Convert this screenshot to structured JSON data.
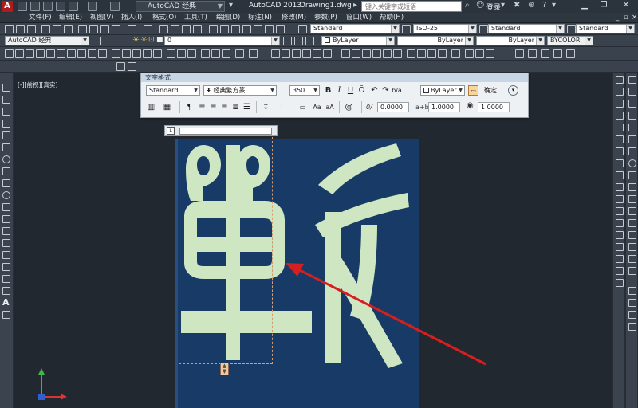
{
  "titlebar": {
    "logo": "A",
    "workspace": "AutoCAD 经典",
    "app_name": "AutoCAD 2013",
    "document": "Drawing1.dwg",
    "search_placeholder": "键入关键字或短语",
    "login": "登录"
  },
  "menu": [
    "文件(F)",
    "编辑(E)",
    "视图(V)",
    "插入(I)",
    "格式(O)",
    "工具(T)",
    "绘图(D)",
    "标注(N)",
    "修改(M)",
    "参数(P)",
    "窗口(W)",
    "帮助(H)"
  ],
  "toolbars": {
    "text_style": "Standard",
    "dim_style": "ISO-25",
    "table_style": "Standard",
    "multileader_style": "Standard",
    "workspace": "AutoCAD 经典",
    "layer": "0",
    "color": "ByLayer",
    "linetype": "ByLayer",
    "lineweight": "ByLayer",
    "plotstyle": "BYCOLOR"
  },
  "viewport": {
    "label": "[-][前视][真实]"
  },
  "text_format": {
    "title": "文字格式",
    "style": "Standard",
    "font": "经典繁方篆",
    "height": "350",
    "bold": "B",
    "italic": "I",
    "underline": "U",
    "overline": "Ō",
    "color": "ByLayer",
    "ok_label": "确定",
    "oblique": "0.0000",
    "tracking": "1.0000",
    "width_factor": "1.0000",
    "tracking_prefix": "a+b",
    "oblique_prefix": "0/"
  },
  "colors": {
    "editor_bg": "#173b66",
    "glyph": "#cfe6c3",
    "arrow": "#d42020",
    "app_logo": "#b31b1b"
  }
}
